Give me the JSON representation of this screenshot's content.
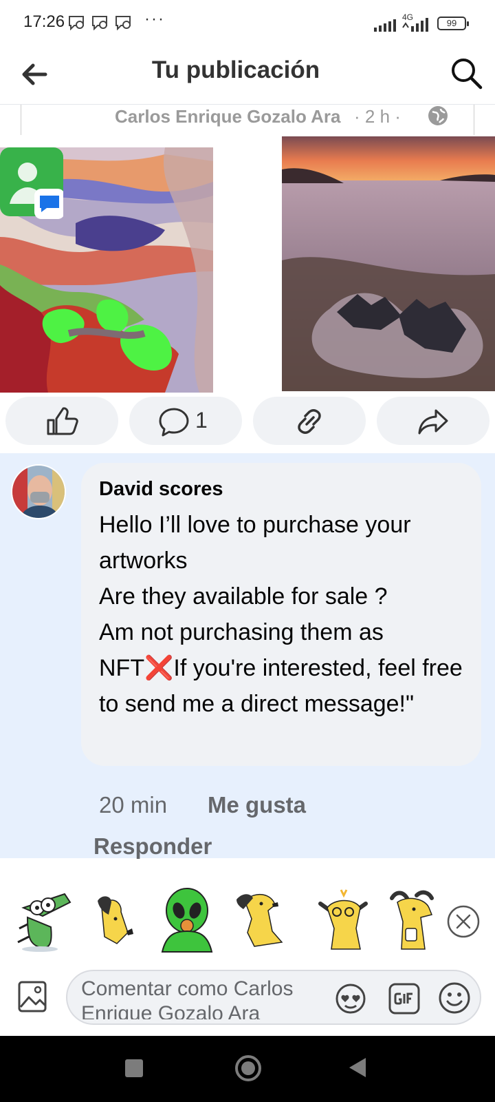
{
  "status_bar": {
    "time": "17:26",
    "dots": "···",
    "network": "4G",
    "battery": "99"
  },
  "header": {
    "title": "Tu publicación"
  },
  "post": {
    "author": "Carlos Enrique Gozalo Ara",
    "meta": "· 2 h ·"
  },
  "actions": {
    "comment_count": "1"
  },
  "comment": {
    "author": "David scores",
    "text": "Hello I’ll love to purchase your artworks\nAre they available for sale ?\nAm not purchasing them as NFT❌If you're interested, feel free to send me a direct message!\"",
    "time": "20 min",
    "like": "Me gusta",
    "reply": "Responder"
  },
  "composer": {
    "placeholder": "Comentar como Carlos Enrique Gozalo Ara"
  },
  "colors": {
    "accent_bg": "#e7f0fd",
    "bubble": "#f0f2f5",
    "muted": "#65676b"
  }
}
